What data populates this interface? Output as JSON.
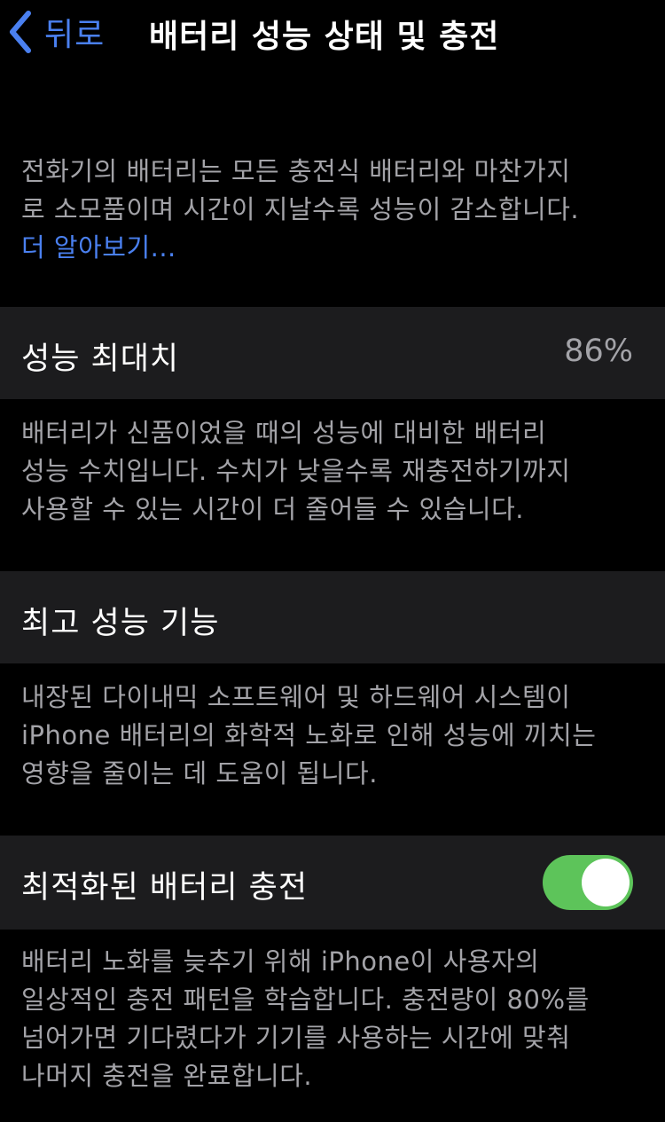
{
  "nav": {
    "back_label": "뒤로",
    "title": "배터리 성능 상태 및 충전"
  },
  "intro": {
    "lines": [
      "전화기의 배터리는 모든 충전식 배터리와 마찬가지",
      "로 소모품이며 시간이 지날수록 성능이 감소합니다."
    ],
    "link": "더 알아보기..."
  },
  "max_capacity": {
    "label": "성능 최대치",
    "value": "86%",
    "description": [
      "배터리가 신품이었을 때의 성능에 대비한 배터리",
      "성능 수치입니다. 수치가 낮을수록 재충전하기까지",
      "사용할 수 있는 시간이 더 줄어들 수 있습니다."
    ]
  },
  "peak_performance": {
    "label": "최고 성능 기능",
    "description": [
      "내장된 다이내믹 소프트웨어 및 하드웨어 시스템이",
      "iPhone 배터리의 화학적 노화로 인해 성능에 끼치는",
      "영향을 줄이는 데 도움이 됩니다."
    ]
  },
  "optimized_charging": {
    "label": "최적화된 배터리 충전",
    "toggle_on": true,
    "description": [
      "배터리 노화를 늦추기 위해 iPhone이 사용자의",
      "일상적인 충전 패턴을 학습합니다. 충전량이 80%를",
      "넘어가면 기다렸다가 기기를 사용하는 시간에 맞춰",
      "나머지 충전을 완료합니다."
    ]
  },
  "colors": {
    "background": "#000000",
    "cell": "#1c1c1e",
    "accent": "#4a80f0",
    "toggle_on": "#5dc45a",
    "secondary_text": "#a3a3a8"
  }
}
